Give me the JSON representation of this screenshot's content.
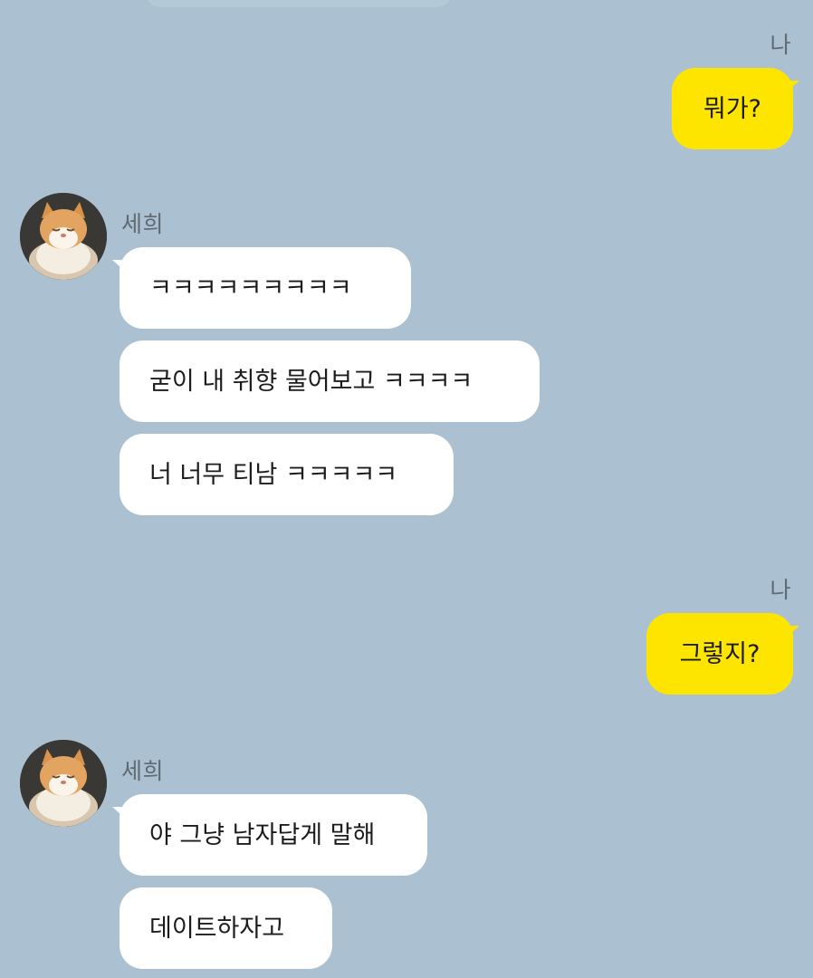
{
  "chat": {
    "messages": [
      {
        "sender": "나",
        "text": "뭐가?"
      },
      {
        "sender": "세희",
        "text": "ㅋㅋㅋㅋㅋㅋㅋㅋㅋ"
      },
      {
        "sender": "세희",
        "text": "굳이 내 취향 물어보고 ㅋㅋㅋㅋ"
      },
      {
        "sender": "세희",
        "text": "너 너무 티남 ㅋㅋㅋㅋㅋ"
      },
      {
        "sender": "나",
        "text": "그렇지?"
      },
      {
        "sender": "세희",
        "text": "야 그냥 남자답게 말해"
      },
      {
        "sender": "세희",
        "text": "데이트하자고"
      }
    ]
  },
  "colors": {
    "background": "#abc1d1",
    "my_bubble": "#fee500",
    "their_bubble": "#ffffff"
  },
  "icons": {
    "avatar": "cat-avatar"
  }
}
